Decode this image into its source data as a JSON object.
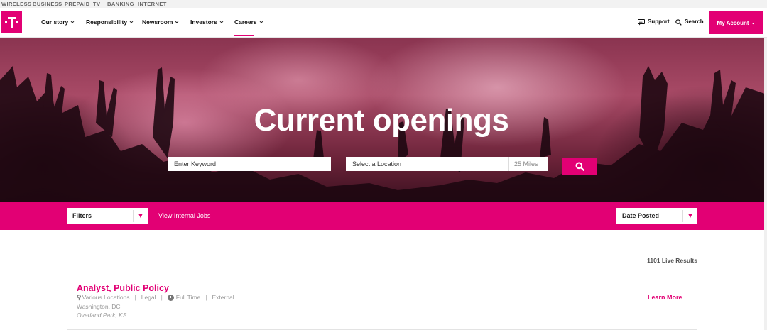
{
  "utility_nav": [
    "WIRELESS",
    "BUSINESS",
    "PREPAID",
    "TV",
    "BANKING",
    "INTERNET"
  ],
  "main_nav": {
    "items": [
      {
        "label": "Our story"
      },
      {
        "label": "Responsibility"
      },
      {
        "label": "Newsroom"
      },
      {
        "label": "Investors"
      },
      {
        "label": "Careers"
      }
    ],
    "active": "Careers",
    "support_label": "Support",
    "search_label": "Search",
    "account_label": "My Account"
  },
  "hero": {
    "title": "Current openings",
    "keyword_placeholder": "Enter Keyword",
    "location_placeholder": "Select a Location",
    "radius": "25 Miles"
  },
  "filters": {
    "filters_label": "Filters",
    "internal_jobs_link": "View Internal Jobs",
    "sort_label": "Date Posted"
  },
  "results": {
    "count_text": "1101 Live Results",
    "jobs": [
      {
        "title": "Analyst, Public Policy",
        "location": "Various Locations",
        "category": "Legal",
        "type": "Full Time",
        "audience": "External",
        "extra_locations": [
          "Washington, DC",
          "Overland Park, KS"
        ],
        "cta": "Learn More"
      }
    ]
  },
  "colors": {
    "brand": "#e20074",
    "nav_bg": "#ffffff",
    "utility_bg": "#f2f2f2"
  },
  "icons": [
    "tmobile-logo",
    "chat-icon",
    "search-icon",
    "chevron-down-icon",
    "location-pin-icon",
    "clock-icon"
  ]
}
